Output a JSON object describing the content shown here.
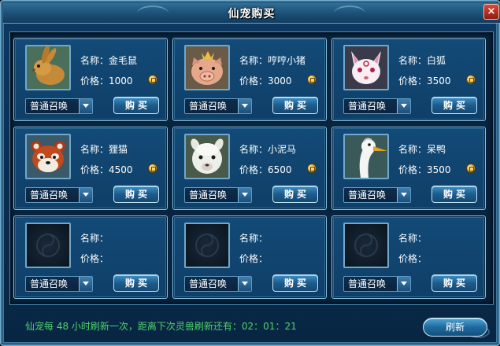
{
  "window": {
    "title": "仙宠购买",
    "close_label": "×"
  },
  "labels": {
    "name_prefix": "名称：",
    "price_prefix": "价格："
  },
  "cards": [
    {
      "pet": "rabbit-icon",
      "name": "金毛鼠",
      "price": "1000",
      "summon": "普通召唤",
      "buy_label": "购买"
    },
    {
      "pet": "pig-icon",
      "name": "哼哼小猪",
      "price": "3000",
      "summon": "普通召唤",
      "buy_label": "购买"
    },
    {
      "pet": "fox-icon",
      "name": "白狐",
      "price": "3500",
      "summon": "普通召唤",
      "buy_label": "购买"
    },
    {
      "pet": "red-panda-icon",
      "name": "狸猫",
      "price": "4500",
      "summon": "普通召唤",
      "buy_label": "购买"
    },
    {
      "pet": "alpaca-icon",
      "name": "小泥马",
      "price": "6500",
      "summon": "普通召唤",
      "buy_label": "购买"
    },
    {
      "pet": "duck-icon",
      "name": "呆鸭",
      "price": "3500",
      "summon": "普通召唤",
      "buy_label": "购买"
    },
    {
      "pet": "empty-slot-icon",
      "name": "",
      "price": "",
      "summon": "普通召唤",
      "buy_label": "购买"
    },
    {
      "pet": "empty-slot-icon",
      "name": "",
      "price": "",
      "summon": "普通召唤",
      "buy_label": "购买"
    },
    {
      "pet": "empty-slot-icon",
      "name": "",
      "price": "",
      "summon": "普通召唤",
      "buy_label": "购买"
    }
  ],
  "footer": {
    "refresh_info": "仙宠每 48 小时刷新一次，距离下次灵兽刷新还有：02：01：21",
    "refresh_button": "刷新"
  },
  "colors": {
    "background": "#0a2c4f",
    "card_border": "#8fc1e0",
    "footer_text": "#4ed36a",
    "coin": "#d6a12a"
  }
}
